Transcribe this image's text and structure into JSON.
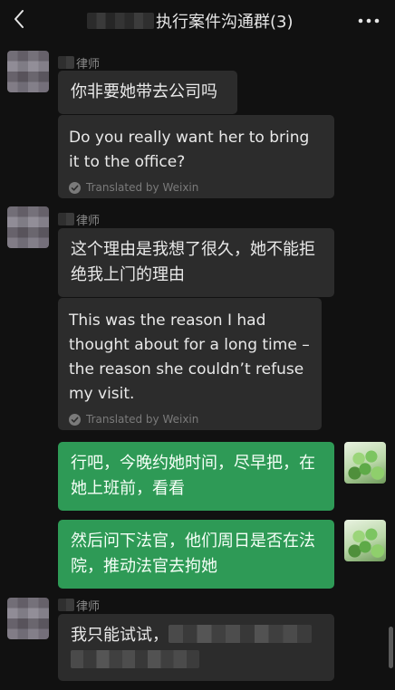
{
  "header": {
    "title": "执行案件沟通群(3)",
    "back_icon": "chevron-left-icon",
    "more_icon": "more-dots-icon"
  },
  "messages": [
    {
      "sender": "律师",
      "text": "你非要她带去公司吗",
      "translation": "Do you really want her to bring it to the office?",
      "translated_by": "Translated by Weixin"
    },
    {
      "sender": "律师",
      "text": "这个理由是我想了很久，她不能拒绝我上门的理由",
      "translation": "This was the reason I had thought about for a long time – the reason she couldn’t refuse my visit.",
      "translated_by": "Translated by Weixin"
    },
    {
      "self": true,
      "text": "行吧，今晚约她时间，尽早把，在她上班前，看看"
    },
    {
      "self": true,
      "text": "然后问下法官，他们周日是否在法院，推动法官去拘她"
    },
    {
      "sender": "律师",
      "text_prefix": "我只能试试，"
    }
  ],
  "colors": {
    "background": "#111111",
    "bubble_in": "#2c2c2c",
    "bubble_out": "#2e9a56"
  }
}
